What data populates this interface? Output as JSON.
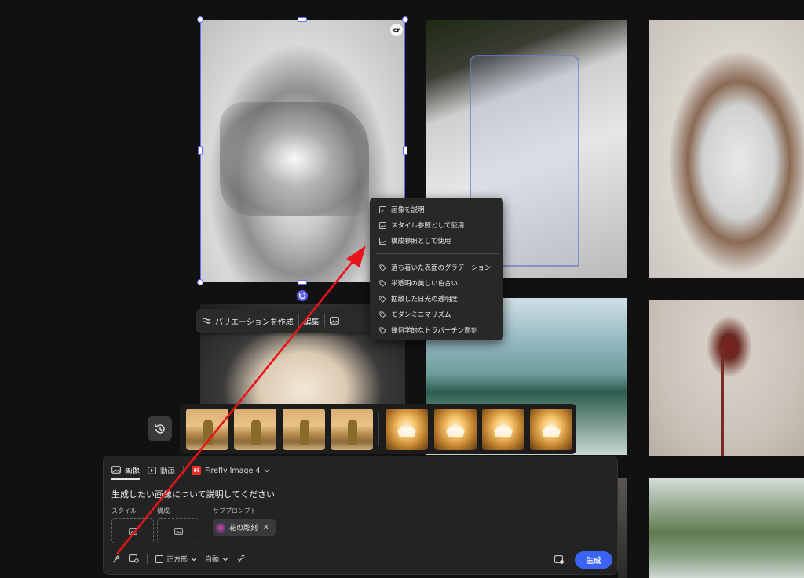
{
  "selected_image": {
    "badge": "cr"
  },
  "variation_toolbar": {
    "create_variations_label": "バリエーションを作成",
    "edit_label": "編集"
  },
  "context_menu": {
    "actions": [
      {
        "label": "画像を説明",
        "icon": "describe-image-icon"
      },
      {
        "label": "スタイル参照として使用",
        "icon": "style-reference-icon"
      },
      {
        "label": "構成参照として使用",
        "icon": "composition-reference-icon"
      }
    ],
    "tags": [
      {
        "label": "落ち着いた表面のグラデーション",
        "icon": "tag-icon"
      },
      {
        "label": "半透明の美しい色合い",
        "icon": "tag-icon"
      },
      {
        "label": "拡散した日光の透明度",
        "icon": "tag-icon"
      },
      {
        "label": "モダンミニマリズム",
        "icon": "tag-icon"
      },
      {
        "label": "幾何学的なトラバーチン彫刻",
        "icon": "tag-icon"
      }
    ]
  },
  "prompt_panel": {
    "tabs": [
      {
        "label": "画像",
        "active": true
      },
      {
        "label": "動画",
        "active": false
      }
    ],
    "model": {
      "badge": "Fi",
      "label": "Firefly Image 4"
    },
    "prompt_placeholder": "生成したい画像について説明してください",
    "style_label": "スタイル",
    "composition_label": "構成",
    "subprompt_label": "サブプロンプト",
    "subprompt_chip": "花の彫刻",
    "aspect_label": "正方形",
    "content_type_label": "自動",
    "generate_label": "生成"
  },
  "colors": {
    "accent": "#3b63f5",
    "selection": "#6b6cf6",
    "annotation_arrow": "#e8141a",
    "firefly_badge": "#e0312a"
  }
}
